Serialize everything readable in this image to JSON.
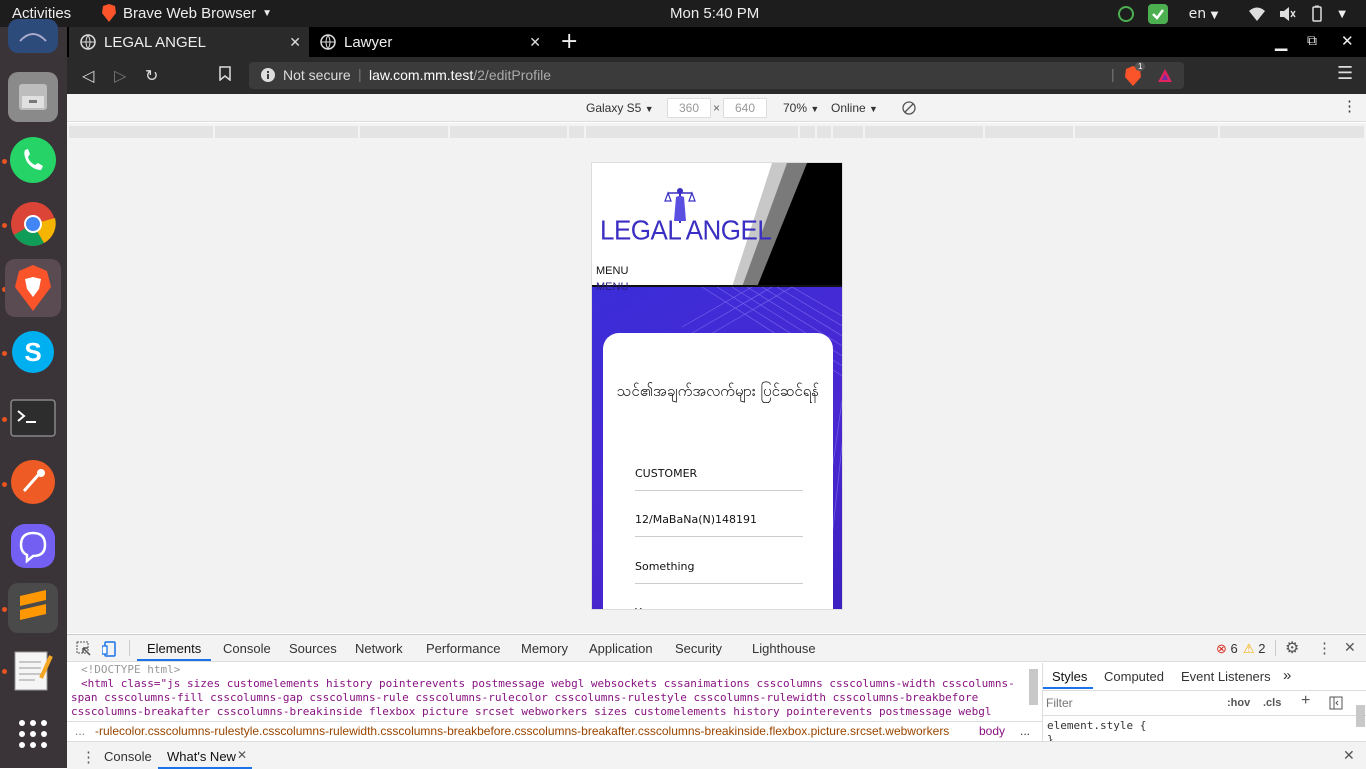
{
  "system": {
    "activities": "Activities",
    "app_menu": "Brave Web Browser",
    "clock": "Mon  5:40 PM",
    "language": "en"
  },
  "browser": {
    "tabs": [
      {
        "label": "LEGAL ANGEL",
        "active": true
      },
      {
        "label": "Lawyer",
        "active": false
      }
    ],
    "security_label": "Not secure",
    "url_host": "law.com.mm.test",
    "url_path": "/2/editProfile",
    "shield_count": "1"
  },
  "device_toolbar": {
    "device": "Galaxy S5",
    "width": "360",
    "times": "×",
    "height": "640",
    "zoom": "70%",
    "throttle": "Online"
  },
  "page": {
    "logo_text": "LEGAL ANGEL",
    "menu_label": "MENU",
    "menu_label_2": "MENU",
    "form_title": "သင်၏အချက်အလက်များ ပြင်ဆင်ရန်",
    "fields": [
      "CUSTOMER",
      "12/MaBaNa(N)148191",
      "Something",
      "Yangon"
    ]
  },
  "devtools": {
    "tabs": [
      "Elements",
      "Console",
      "Sources",
      "Network",
      "Performance",
      "Memory",
      "Application",
      "Security",
      "Lighthouse"
    ],
    "error_count": "6",
    "warning_count": "2",
    "doctype": "<!DOCTYPE html>",
    "html_line_1": "<html class=\"js sizes customelements history pointerevents postmessage webgl websockets cssanimations csscolumns csscolumns-width csscolumns-",
    "html_line_2": "span csscolumns-fill csscolumns-gap csscolumns-rule csscolumns-rulecolor csscolumns-rulestyle csscolumns-rulewidth csscolumns-breakbefore",
    "html_line_3": "csscolumns-breakafter csscolumns-breakinside flexbox picture srcset webworkers sizes customelements history pointerevents postmessage webgl",
    "breadcrumb_ellipsis": "...",
    "breadcrumb_path": "-rulecolor.csscolumns-rulestyle.csscolumns-rulewidth.csscolumns-breakbefore.csscolumns-breakafter.csscolumns-breakinside.flexbox.picture.srcset.webworkers",
    "breadcrumb_body": "body",
    "breadcrumb_more": "...",
    "styles_tabs": [
      "Styles",
      "Computed",
      "Event Listeners"
    ],
    "filter_placeholder": "Filter",
    "hov": ":hov",
    "cls": ".cls",
    "element_style": "element.style {",
    "element_style_close": "}",
    "drawer_tabs": [
      "Console",
      "What's New"
    ]
  },
  "colors": {
    "accent": "#1a73e8",
    "hero": "#3a2dd8",
    "logo": "#3a2fc2"
  }
}
